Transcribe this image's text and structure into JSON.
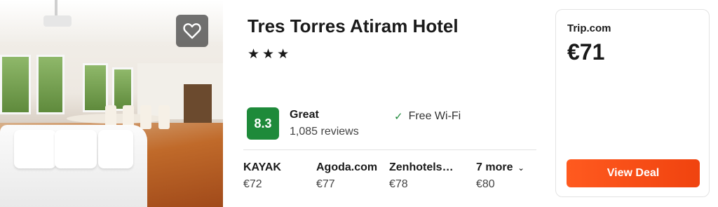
{
  "hotel": {
    "name": "Tres Torres Atiram Hotel",
    "stars_text": "★★★",
    "star_count": 3
  },
  "rating": {
    "score": "8.3",
    "label": "Great",
    "reviews": "1,085 reviews",
    "color": "#1e8a3a"
  },
  "amenities": [
    {
      "icon": "check-icon",
      "label": "Free Wi-Fi"
    }
  ],
  "providers": [
    {
      "name": "KAYAK",
      "price": "€72"
    },
    {
      "name": "Agoda.com",
      "price": "€77"
    },
    {
      "name": "Zenhotels.com",
      "price": "€78"
    }
  ],
  "more_providers": {
    "label": "7 more",
    "price": "€80"
  },
  "deal": {
    "site": "Trip.com",
    "price": "€71",
    "button_label": "View Deal",
    "button_color": "#f0430f"
  },
  "icons": {
    "favorite": "heart-icon",
    "more": "chevron-down-icon"
  }
}
